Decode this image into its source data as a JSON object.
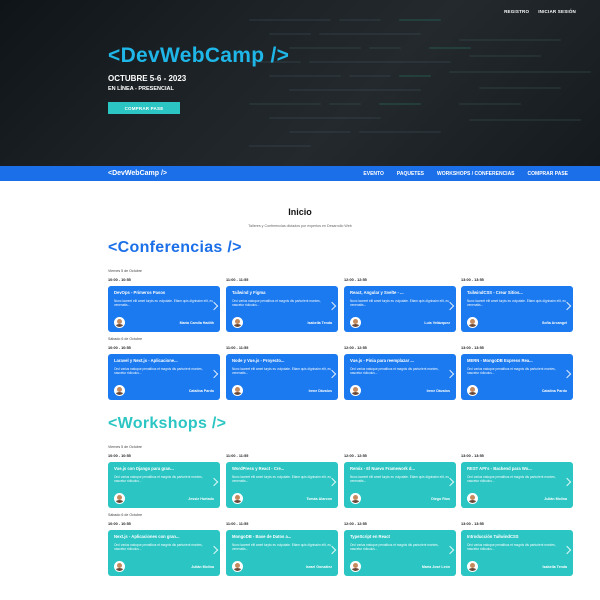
{
  "hero": {
    "top_links": [
      "REGISTRO",
      "INICIAR SESIÓN"
    ],
    "brand": "<DevWebCamp />",
    "date": "OCTUBRE 5-6 - 2023",
    "mode": "EN LÍNEA - PRESENCIAL",
    "cta": "COMPRAR PASE"
  },
  "navbar": {
    "logo": "<DevWebCamp />",
    "links": [
      "EVENTO",
      "PAQUETES",
      "WORKSHOPS / CONFERENCIAS",
      "COMPRAR PASE"
    ]
  },
  "main": {
    "title": "Inicio",
    "subtitle": "Talleres y Conferencias dictados por expertos en Desarrollo Web",
    "sections": [
      {
        "title": "<Conferencias />",
        "color": "#1b6fe8",
        "days": [
          {
            "label": "Viernes 5 de Octubre",
            "events": [
              {
                "time": "10:00 - 10:55",
                "title": "DevOps - Primeros Pasos",
                "desc": "Nunc laoreet elit amet turpis eu vulputate. Etiam quis dignissim elit, eu venenatis...",
                "speaker": "María Camila Hadith"
              },
              {
                "time": "11:00 - 11:55",
                "title": "Tailwind y Figma",
                "desc": "Orci varius natoque penatibus et magnis dis parturient montes, nascetur ridiculus...",
                "speaker": "Isabella Tenda"
              },
              {
                "time": "12:00 - 12:55",
                "title": "React, Angular y Svelte - ...",
                "desc": "Nunc laoreet elit amet turpis eu vulputate. Etiam quis dignissim elit, eu venenatis...",
                "speaker": "Luis Velázquez"
              },
              {
                "time": "13:00 - 13:55",
                "title": "TailwindCSS - Crear Sitios...",
                "desc": "Nunc laoreet elit amet turpis eu vulputate. Etiam quis dignissim elit, eu venenatis...",
                "speaker": "Sofía Arcangel"
              }
            ]
          },
          {
            "label": "Sábado 6 de Octubre",
            "events": [
              {
                "time": "10:00 - 10:55",
                "title": "Laravel y Next.js - Aplicacione...",
                "desc": "Orci varius natoque penatibus et magnis dis parturient montes, nascetur ridiculus...",
                "speaker": "Catalina Pardo"
              },
              {
                "time": "11:00 - 11:55",
                "title": "Node y Vue.js - Proyecto...",
                "desc": "Nunc laoreet elit amet turpis eu vulputate. Etiam quis dignissim elit, eu venenatis...",
                "speaker": "Irene Dávalos"
              },
              {
                "time": "12:00 - 12:55",
                "title": "Vue.js - Pinia para reemplazar ...",
                "desc": "Orci varius natoque penatibus et magnis dis parturient montes, nascetur ridiculus...",
                "speaker": "Irene Dávalos"
              },
              {
                "time": "13:00 - 13:55",
                "title": "MERN - MongoDB Express Rea...",
                "desc": "Orci varius natoque penatibus et magnis dis parturient montes, nascetur ridiculus...",
                "speaker": "Catalina Pardo"
              }
            ]
          }
        ]
      },
      {
        "title": "<Workshops />",
        "color": "#2bc6c3",
        "days": [
          {
            "label": "Viernes 5 de Octubre",
            "events": [
              {
                "time": "10:00 - 10:55",
                "title": "Vue.js con Django para gran...",
                "desc": "Orci varius natoque penatibus et magnis dis parturient montes, nascetur ridiculus...",
                "speaker": "Jessie Hurtado"
              },
              {
                "time": "11:00 - 11:55",
                "title": "WordPress y React - Cre...",
                "desc": "Nunc laoreet elit amet turpis eu vulputate. Etiam quis dignissim elit, eu venenatis...",
                "speaker": "Tomás Alarcon"
              },
              {
                "time": "12:00 - 12:55",
                "title": "Remix - El Nuevo Framework d...",
                "desc": "Nunc laoreet elit amet turpis eu vulputate. Etiam quis dignissim elit, eu venenatis...",
                "speaker": "Diego Ríos"
              },
              {
                "time": "13:00 - 13:55",
                "title": "REST API's - Backend para Wo...",
                "desc": "Orci varius natoque penatibus et magnis dis parturient montes, nascetur ridiculus...",
                "speaker": "Julián Molina"
              }
            ]
          },
          {
            "label": "Sábado 6 de Octubre",
            "events": [
              {
                "time": "10:00 - 10:55",
                "title": "Next.js - Aplicaciones con gran...",
                "desc": "Orci varius natoque penatibus et magnis dis parturient montes, nascetur ridiculus...",
                "speaker": "Julián Molina"
              },
              {
                "time": "11:00 - 11:55",
                "title": "MongoDB - Base de Datos a...",
                "desc": "Nunc laoreet elit amet turpis eu vulputate. Etiam quis dignissim elit, eu venenatis...",
                "speaker": "Israel González"
              },
              {
                "time": "12:00 - 12:55",
                "title": "TypeScript en React",
                "desc": "Orci varius natoque penatibus et magnis dis parturient montes, nascetur ridiculus...",
                "speaker": "María José León"
              },
              {
                "time": "13:00 - 13:55",
                "title": "Introducción TailwindCSS",
                "desc": "Orci varius natoque penatibus et magnis dis parturient montes, nascetur ridiculus...",
                "speaker": "Isabella Tenda"
              }
            ]
          }
        ]
      }
    ]
  }
}
